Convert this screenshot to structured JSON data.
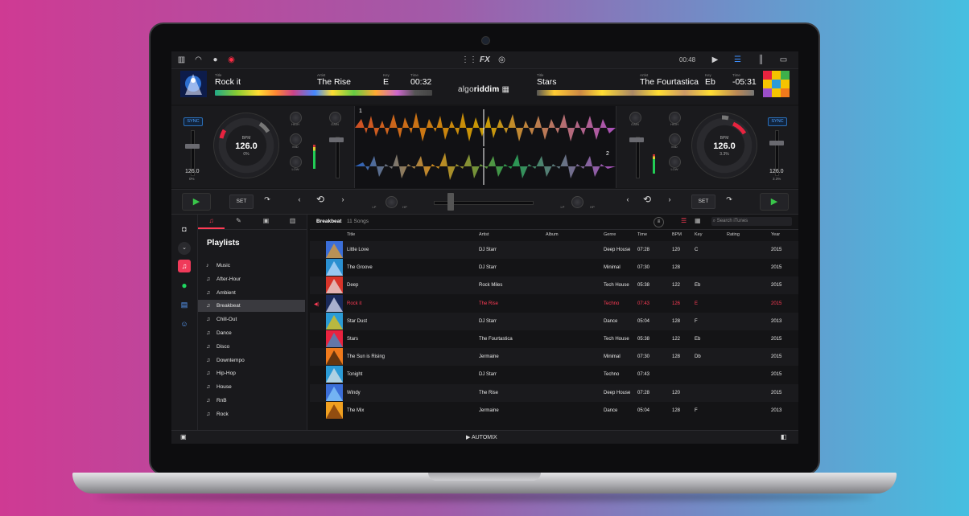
{
  "app": {
    "logo_light": "algo",
    "logo_bold": "riddim",
    "clock": "00:48"
  },
  "deck_left": {
    "title_label": "Title",
    "title": "Rock it",
    "artist_label": "Artist",
    "artist": "The Rise",
    "key_label": "Key",
    "key": "E",
    "time_label": "Time",
    "time": "00:32",
    "sync": "SYNC",
    "bpm_label": "BPM",
    "bpm": "126.0",
    "pitch_pct": "0%",
    "pitch_value": "126.0",
    "pitch_pct_small": "0%",
    "deck_number": "1",
    "accent": "#e8233f"
  },
  "deck_right": {
    "title_label": "Title",
    "title": "Stars",
    "artist_label": "Artist",
    "artist": "The Fourtastica",
    "key_label": "Key",
    "key": "Eb",
    "time_label": "Time",
    "time": "-05:31",
    "sync": "SYNC",
    "bpm_label": "BPM",
    "bpm": "126.0",
    "pitch_pct": "3.3%",
    "pitch_value": "126.0",
    "pitch_pct_small": "3.3%",
    "deck_number": "2",
    "accent": "#e8233f"
  },
  "mixer": {
    "high": "HIGH",
    "mid": "MID",
    "low": "LOW",
    "gain": "GAIN",
    "lp": "LP",
    "hp": "HP"
  },
  "transport": {
    "set": "SET"
  },
  "sources": {
    "icons": [
      "camera-icon",
      "chevron-down-icon",
      "music-icon",
      "spotify-icon",
      "video-icon",
      "finder-icon"
    ]
  },
  "sidebar": {
    "heading": "Playlists",
    "items": [
      "Music",
      "After-Hour",
      "Ambient",
      "Breakbeat",
      "Chill-Out",
      "Dance",
      "Disco",
      "Downtempo",
      "Hip-Hop",
      "House",
      "RnB",
      "Rock"
    ],
    "selected_index": 3
  },
  "library": {
    "playlist": "Breakbeat",
    "count": "11 Songs",
    "search_placeholder": "Search iTunes",
    "columns": {
      "title": "Title",
      "artist": "Artist",
      "album": "Album",
      "genre": "Genre",
      "time": "Time",
      "bpm": "BPM",
      "key": "Key",
      "rating": "Rating",
      "year": "Year"
    },
    "rows": [
      {
        "title": "Little Love",
        "artist": "DJ Starr",
        "album": "",
        "genre": "Deep House",
        "time": "07:28",
        "bpm": "120",
        "key": "C",
        "year": "2015"
      },
      {
        "title": "The Groove",
        "artist": "DJ Starr",
        "album": "",
        "genre": "Minimal",
        "time": "07:30",
        "bpm": "128",
        "key": "",
        "year": "2015"
      },
      {
        "title": "Deep",
        "artist": "Rock Miles",
        "album": "",
        "genre": "Tech House",
        "time": "05:38",
        "bpm": "122",
        "key": "Eb",
        "year": "2015"
      },
      {
        "title": "Rock it",
        "artist": "The Rise",
        "album": "",
        "genre": "Techno",
        "time": "07:43",
        "bpm": "126",
        "key": "E",
        "year": "2015"
      },
      {
        "title": "Star Dust",
        "artist": "DJ Starr",
        "album": "",
        "genre": "Dance",
        "time": "05:04",
        "bpm": "128",
        "key": "F",
        "year": "2013"
      },
      {
        "title": "Stars",
        "artist": "The Fourtastica",
        "album": "",
        "genre": "Tech House",
        "time": "05:38",
        "bpm": "122",
        "key": "Eb",
        "year": "2015"
      },
      {
        "title": "The Sun is Rising",
        "artist": "Jermaine",
        "album": "",
        "genre": "Minimal",
        "time": "07:30",
        "bpm": "128",
        "key": "Db",
        "year": "2015"
      },
      {
        "title": "Tonight",
        "artist": "DJ Starr",
        "album": "",
        "genre": "Techno",
        "time": "07:43",
        "bpm": "",
        "key": "",
        "year": "2015"
      },
      {
        "title": "Windy",
        "artist": "The Rise",
        "album": "",
        "genre": "Deep House",
        "time": "07:28",
        "bpm": "120",
        "key": "",
        "year": "2015"
      },
      {
        "title": "The Mix",
        "artist": "Jermaine",
        "album": "",
        "genre": "Dance",
        "time": "05:04",
        "bpm": "128",
        "key": "F",
        "year": "2013"
      }
    ],
    "playing_index": 3
  },
  "footer": {
    "automix": "AUTOMIX"
  }
}
